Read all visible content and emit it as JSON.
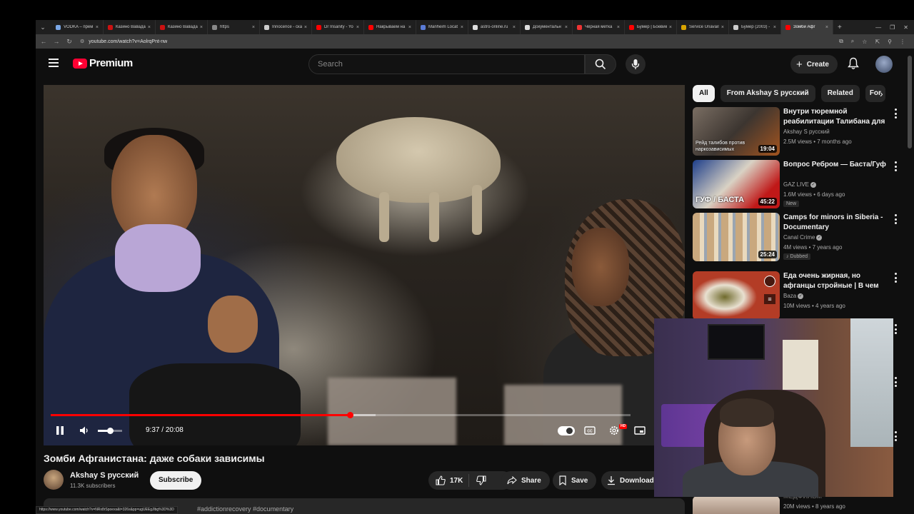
{
  "browser": {
    "tabs": [
      {
        "title": "VODKA – прем",
        "color": "#7aa7e6"
      },
      {
        "title": "Казино Вавада",
        "color": "#c11"
      },
      {
        "title": "Казино Вавада",
        "color": "#c11"
      },
      {
        "title": "https",
        "color": "#888"
      },
      {
        "title": "Innocence - скач",
        "color": "#ccc"
      },
      {
        "title": "Dr Insanity - Yo",
        "color": "#f00"
      },
      {
        "title": "Накрываем на",
        "color": "#f00"
      },
      {
        "title": "Manheim Locat",
        "color": "#5a7bd6"
      },
      {
        "title": "astro-online.ru",
        "color": "#ddd"
      },
      {
        "title": "Документальн",
        "color": "#ddd"
      },
      {
        "title": "Чёрная метка",
        "color": "#e33"
      },
      {
        "title": "Бумер | Боевик",
        "color": "#f00"
      },
      {
        "title": "Service Unavail",
        "color": "#d9a400"
      },
      {
        "title": "Бумер (2003) -",
        "color": "#ccc"
      },
      {
        "title": "Зомби Афг",
        "color": "#f00"
      }
    ],
    "url": "youtube.com/watch?v=AolrqPnt-nw",
    "status_url": "https://www.youtube.com/watch?v=NRx8rSpoexs&t=326s&pp=ugUEEgJlbg%3D%3D"
  },
  "header": {
    "brand": "Premium",
    "search_placeholder": "Search",
    "create_label": "Create"
  },
  "player": {
    "current_time": "9:37",
    "duration": "20:08",
    "progress_fraction": 0.516,
    "buffer_fraction": 0.56,
    "volume_fraction": 0.5
  },
  "video": {
    "title": "Зомби Афганистана: даже собаки зависимы",
    "channel": "Akshay S русский",
    "subscribers": "11.3K subscribers",
    "subscribe_label": "Subscribe",
    "likes": "17K",
    "share_label": "Share",
    "save_label": "Save",
    "download_label": "Download",
    "hashtags": "#addictionrecovery #documentary"
  },
  "chips": [
    "All",
    "From Akshay S русский",
    "Related",
    "For"
  ],
  "recommendations": [
    {
      "title": "Внутри тюремной реабилитации Талибана для ...",
      "channel": "Akshay S русский",
      "verified": false,
      "meta": "2.5M views • 7 months ago",
      "duration": "19:04",
      "thumb_caption": "Рейд талибов против наркозависимых",
      "badge": ""
    },
    {
      "title": "Вопрос Ребром — Баста/Гуф",
      "channel": "GAZ LIVE",
      "verified": true,
      "meta": "1.6M views • 6 days ago",
      "duration": "45:22",
      "thumb_caption": "ГУФ / БАСТА",
      "badge": "New"
    },
    {
      "title": "Camps for minors in Siberia - Documentary",
      "channel": "Canal Crime",
      "verified": true,
      "meta": "4M views • 7 years ago",
      "duration": "25:24",
      "thumb_caption": "",
      "badge": "Dubbed"
    },
    {
      "title": "Еда очень жирная, но афганцы стройные | В чем и...",
      "channel": "Baza",
      "verified": true,
      "meta": "10M views • 4 years ago",
      "duration": "",
      "thumb_caption": "",
      "badge": ""
    }
  ],
  "partial_rec": {
    "title": "МЕДФИЛЬМ",
    "meta": "20M views • 8 years ago"
  },
  "colors": {
    "accent": "#ff0000",
    "background": "#0f0f0f",
    "chip_bg": "#272727"
  }
}
